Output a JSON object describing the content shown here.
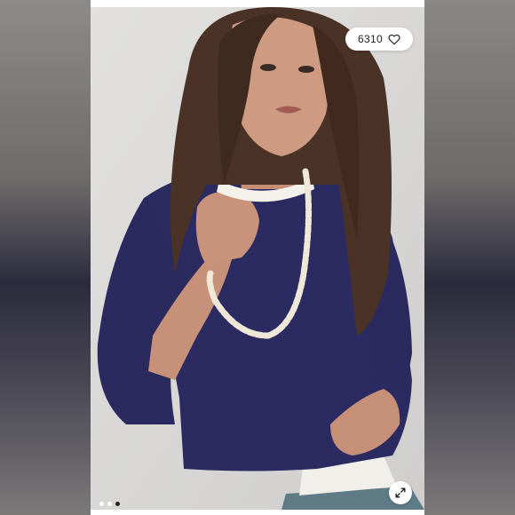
{
  "listing": {
    "like_count": "6310",
    "like_icon": "heart-outline-icon",
    "expand_icon": "expand-arrows-icon",
    "carousel": {
      "total": 3,
      "active_index": 2
    }
  },
  "colors": {
    "sweater": "#2b2b62",
    "background": "#d9d8d6",
    "pill": "#ffffff"
  }
}
